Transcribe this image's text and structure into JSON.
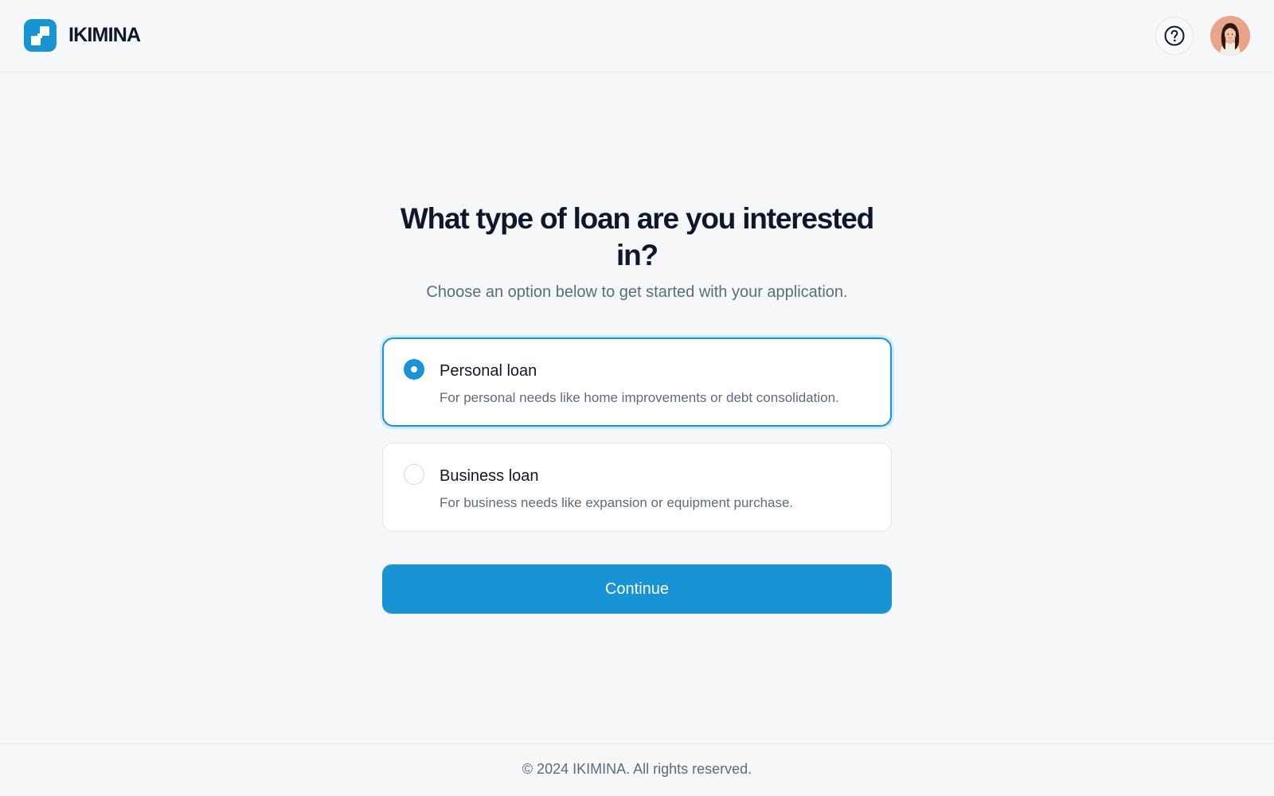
{
  "header": {
    "brand": "IKIMINA",
    "logo_icon": "ikimina-logo-icon",
    "help_icon": "question-circle-icon",
    "avatar_icon": "user-avatar"
  },
  "main": {
    "title": "What type of loan are you interested in?",
    "subtitle": "Choose an option below to get started with your application.",
    "options": [
      {
        "label": "Personal loan",
        "description": "For personal needs like home improvements or debt consolidation.",
        "selected": true
      },
      {
        "label": "Business loan",
        "description": "For business needs like expansion or equipment purchase.",
        "selected": false
      }
    ],
    "continue_label": "Continue"
  },
  "footer": {
    "copyright": "© 2024 IKIMINA. All rights reserved."
  },
  "colors": {
    "accent": "#1793d6",
    "background": "#f6f7f9",
    "card": "#ffffff",
    "text_primary": "#0f172a",
    "text_secondary": "#5f6b7a"
  }
}
